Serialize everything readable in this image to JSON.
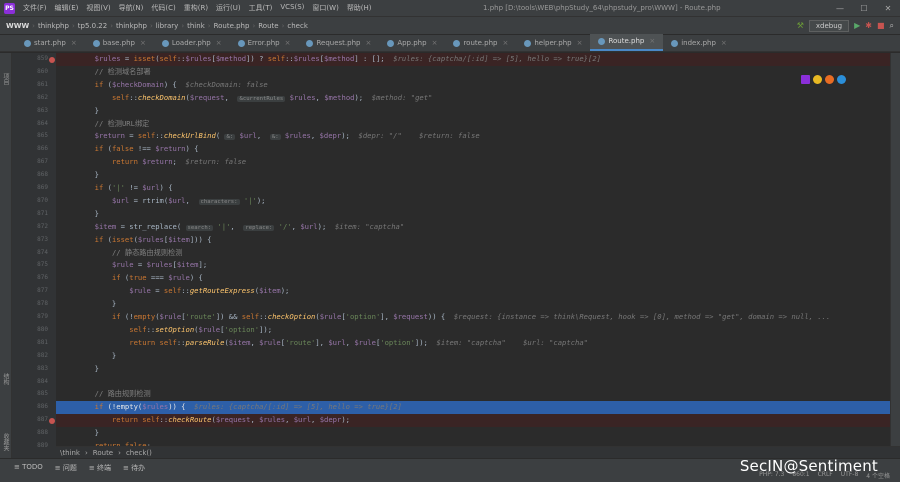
{
  "menubar": {
    "items": [
      "文件(F)",
      "编辑(E)",
      "视图(V)",
      "导航(N)",
      "代码(C)",
      "重构(R)",
      "运行(U)",
      "工具(T)",
      "VCS(S)",
      "窗口(W)",
      "帮助(H)"
    ],
    "title": "1.php [D:\\tools\\WEB\\phpStudy_64\\phpstudy_pro\\WWW] - Route.php"
  },
  "navbar": {
    "crumbs": [
      "WWW",
      "thinkphp",
      "tp5.0.22",
      "thinkphp",
      "library",
      "think",
      "Route.php",
      "Route",
      "check"
    ],
    "debug_config": "xdebug"
  },
  "tabs": [
    "start.php",
    "base.php",
    "Loader.php",
    "Error.php",
    "Request.php",
    "App.php",
    "route.php",
    "helper.php",
    "Route.php",
    "index.php"
  ],
  "inspections": {
    "warnings": "6",
    "weak_warnings": "222",
    "ok": "15"
  },
  "code": [
    {
      "n": "859",
      "parts": [
        [
          "",
          "        "
        ],
        [
          "v",
          "$rules"
        ],
        [
          "",
          " = "
        ],
        [
          "k",
          "isset"
        ],
        [
          "",
          "("
        ],
        [
          "k",
          "self"
        ],
        [
          "",
          "::"
        ],
        [
          "v",
          "$rules"
        ],
        [
          "",
          "["
        ],
        [
          "v",
          "$method"
        ],
        [
          "",
          "]) ? "
        ],
        [
          "k",
          "self"
        ],
        [
          "",
          "::"
        ],
        [
          "v",
          "$rules"
        ],
        [
          "",
          "["
        ],
        [
          "v",
          "$method"
        ],
        [
          "",
          "] : [];  "
        ],
        [
          "hint",
          "$rules: {captcha/[:id] => [5], hello => true}[2]"
        ]
      ],
      "bp": true,
      "hl": "red"
    },
    {
      "n": "860",
      "parts": [
        [
          "",
          "        "
        ],
        [
          "c",
          "// 检测域名部署"
        ]
      ]
    },
    {
      "n": "861",
      "parts": [
        [
          "",
          "        "
        ],
        [
          "k",
          "if"
        ],
        [
          "",
          " ("
        ],
        [
          "v",
          "$checkDomain"
        ],
        [
          "",
          ") {  "
        ],
        [
          "hint",
          "$checkDomain: false"
        ]
      ]
    },
    {
      "n": "862",
      "parts": [
        [
          "",
          "            "
        ],
        [
          "k",
          "self"
        ],
        [
          "",
          "::"
        ],
        [
          "f",
          "checkDomain"
        ],
        [
          "",
          "("
        ],
        [
          "v",
          "$request"
        ],
        [
          "",
          ",  "
        ],
        [
          "ph",
          "&currentRules"
        ],
        [
          "",
          " "
        ],
        [
          "v",
          "$rules"
        ],
        [
          "",
          ", "
        ],
        [
          "v",
          "$method"
        ],
        [
          "",
          ");  "
        ],
        [
          "hint",
          "$method: \"get\""
        ]
      ]
    },
    {
      "n": "863",
      "parts": [
        [
          "",
          "        }"
        ]
      ]
    },
    {
      "n": "864",
      "parts": [
        [
          "",
          "        "
        ],
        [
          "c",
          "// 检测URL绑定"
        ]
      ]
    },
    {
      "n": "865",
      "parts": [
        [
          "",
          "        "
        ],
        [
          "v",
          "$return"
        ],
        [
          "",
          " = "
        ],
        [
          "k",
          "self"
        ],
        [
          "",
          "::"
        ],
        [
          "f",
          "checkUrlBind"
        ],
        [
          "",
          "( "
        ],
        [
          "ph",
          "&:"
        ],
        [
          "",
          " "
        ],
        [
          "v",
          "$url"
        ],
        [
          "",
          ",  "
        ],
        [
          "ph",
          "&:"
        ],
        [
          "",
          " "
        ],
        [
          "v",
          "$rules"
        ],
        [
          "",
          ", "
        ],
        [
          "v",
          "$depr"
        ],
        [
          "",
          ");  "
        ],
        [
          "hint",
          "$depr: \"/\"    $return: false"
        ]
      ]
    },
    {
      "n": "866",
      "parts": [
        [
          "",
          "        "
        ],
        [
          "k",
          "if"
        ],
        [
          "",
          " ("
        ],
        [
          "k",
          "false"
        ],
        [
          "",
          " !== "
        ],
        [
          "v",
          "$return"
        ],
        [
          "",
          ") {"
        ]
      ]
    },
    {
      "n": "867",
      "parts": [
        [
          "",
          "            "
        ],
        [
          "k",
          "return"
        ],
        [
          "",
          " "
        ],
        [
          "v",
          "$return"
        ],
        [
          "",
          ";  "
        ],
        [
          "hint",
          "$return: false"
        ]
      ]
    },
    {
      "n": "868",
      "parts": [
        [
          "",
          "        }"
        ]
      ]
    },
    {
      "n": "869",
      "parts": [
        [
          "",
          "        "
        ],
        [
          "k",
          "if"
        ],
        [
          "",
          " ("
        ],
        [
          "s",
          "'|'"
        ],
        [
          "",
          " != "
        ],
        [
          "v",
          "$url"
        ],
        [
          "",
          ") {"
        ]
      ]
    },
    {
      "n": "870",
      "parts": [
        [
          "",
          "            "
        ],
        [
          "v",
          "$url"
        ],
        [
          "",
          " = rtrim("
        ],
        [
          "v",
          "$url"
        ],
        [
          "",
          ",  "
        ],
        [
          "ph",
          "characters:"
        ],
        [
          "",
          " "
        ],
        [
          "s",
          "'|'"
        ],
        [
          "",
          ");"
        ]
      ]
    },
    {
      "n": "871",
      "parts": [
        [
          "",
          "        }"
        ]
      ]
    },
    {
      "n": "872",
      "parts": [
        [
          "",
          "        "
        ],
        [
          "v",
          "$item"
        ],
        [
          "",
          " = str_replace( "
        ],
        [
          "ph",
          "search:"
        ],
        [
          "",
          " "
        ],
        [
          "s",
          "'|'"
        ],
        [
          "",
          ",  "
        ],
        [
          "ph",
          "replace:"
        ],
        [
          "",
          " "
        ],
        [
          "s",
          "'/'"
        ],
        [
          "",
          ", "
        ],
        [
          "v",
          "$url"
        ],
        [
          "",
          ");  "
        ],
        [
          "hint",
          "$item: \"captcha\""
        ]
      ]
    },
    {
      "n": "873",
      "parts": [
        [
          "",
          "        "
        ],
        [
          "k",
          "if"
        ],
        [
          "",
          " ("
        ],
        [
          "k",
          "isset"
        ],
        [
          "",
          "("
        ],
        [
          "v",
          "$rules"
        ],
        [
          "",
          "["
        ],
        [
          "v",
          "$item"
        ],
        [
          "",
          "])) {"
        ]
      ]
    },
    {
      "n": "874",
      "parts": [
        [
          "",
          "            "
        ],
        [
          "c",
          "// 静态路由规则检测"
        ]
      ]
    },
    {
      "n": "875",
      "parts": [
        [
          "",
          "            "
        ],
        [
          "v",
          "$rule"
        ],
        [
          "",
          " = "
        ],
        [
          "v",
          "$rules"
        ],
        [
          "",
          "["
        ],
        [
          "v",
          "$item"
        ],
        [
          "",
          "];"
        ]
      ]
    },
    {
      "n": "876",
      "parts": [
        [
          "",
          "            "
        ],
        [
          "k",
          "if"
        ],
        [
          "",
          " ("
        ],
        [
          "k",
          "true"
        ],
        [
          "",
          " === "
        ],
        [
          "v",
          "$rule"
        ],
        [
          "",
          ") {"
        ]
      ]
    },
    {
      "n": "877",
      "parts": [
        [
          "",
          "                "
        ],
        [
          "v",
          "$rule"
        ],
        [
          "",
          " = "
        ],
        [
          "k",
          "self"
        ],
        [
          "",
          "::"
        ],
        [
          "f",
          "getRouteExpress"
        ],
        [
          "",
          "("
        ],
        [
          "v",
          "$item"
        ],
        [
          "",
          ");"
        ]
      ]
    },
    {
      "n": "878",
      "parts": [
        [
          "",
          "            }"
        ]
      ]
    },
    {
      "n": "879",
      "parts": [
        [
          "",
          "            "
        ],
        [
          "k",
          "if"
        ],
        [
          "",
          " (!"
        ],
        [
          "k",
          "empty"
        ],
        [
          "",
          "("
        ],
        [
          "v",
          "$rule"
        ],
        [
          "",
          "["
        ],
        [
          "s",
          "'route'"
        ],
        [
          "",
          "]) && "
        ],
        [
          "k",
          "self"
        ],
        [
          "",
          "::"
        ],
        [
          "f",
          "checkOption"
        ],
        [
          "",
          "("
        ],
        [
          "v",
          "$rule"
        ],
        [
          "",
          "["
        ],
        [
          "s",
          "'option'"
        ],
        [
          "",
          "], "
        ],
        [
          "v",
          "$request"
        ],
        [
          "",
          ")) {  "
        ],
        [
          "hint",
          "$request: {instance => think\\Request, hook => [0], method => \"get\", domain => null, ..."
        ]
      ]
    },
    {
      "n": "880",
      "parts": [
        [
          "",
          "                "
        ],
        [
          "k",
          "self"
        ],
        [
          "",
          "::"
        ],
        [
          "f",
          "setOption"
        ],
        [
          "",
          "("
        ],
        [
          "v",
          "$rule"
        ],
        [
          "",
          "["
        ],
        [
          "s",
          "'option'"
        ],
        [
          "",
          "]);"
        ]
      ]
    },
    {
      "n": "881",
      "parts": [
        [
          "",
          "                "
        ],
        [
          "k",
          "return"
        ],
        [
          "",
          " "
        ],
        [
          "k",
          "self"
        ],
        [
          "",
          "::"
        ],
        [
          "f",
          "parseRule"
        ],
        [
          "",
          "("
        ],
        [
          "v",
          "$item"
        ],
        [
          "",
          ", "
        ],
        [
          "v",
          "$rule"
        ],
        [
          "",
          "["
        ],
        [
          "s",
          "'route'"
        ],
        [
          "",
          "], "
        ],
        [
          "v",
          "$url"
        ],
        [
          "",
          ", "
        ],
        [
          "v",
          "$rule"
        ],
        [
          "",
          "["
        ],
        [
          "s",
          "'option'"
        ],
        [
          "",
          "]);  "
        ],
        [
          "hint",
          "$item: \"captcha\"    $url: \"captcha\""
        ]
      ]
    },
    {
      "n": "882",
      "parts": [
        [
          "",
          "            }"
        ]
      ]
    },
    {
      "n": "883",
      "parts": [
        [
          "",
          "        }"
        ]
      ]
    },
    {
      "n": "884",
      "parts": [
        [
          "",
          ""
        ]
      ]
    },
    {
      "n": "885",
      "parts": [
        [
          "",
          "        "
        ],
        [
          "c",
          "// 路由规则检测"
        ]
      ]
    },
    {
      "n": "886",
      "parts": [
        [
          "",
          "        "
        ],
        [
          "k",
          "if"
        ],
        [
          "",
          " (!empty("
        ],
        [
          "v",
          "$rules"
        ],
        [
          "",
          ")) {  "
        ],
        [
          "hint",
          "$rules: {captcha/[:id] => [5], hello => true}[2]"
        ]
      ],
      "hl": "blue"
    },
    {
      "n": "887",
      "parts": [
        [
          "",
          "            "
        ],
        [
          "k",
          "return"
        ],
        [
          "",
          " "
        ],
        [
          "k",
          "self"
        ],
        [
          "",
          "::"
        ],
        [
          "f",
          "checkRoute"
        ],
        [
          "",
          "("
        ],
        [
          "v",
          "$request"
        ],
        [
          "",
          ", "
        ],
        [
          "v",
          "$rules"
        ],
        [
          "",
          ", "
        ],
        [
          "v",
          "$url"
        ],
        [
          "",
          ", "
        ],
        [
          "v",
          "$depr"
        ],
        [
          "",
          ");"
        ]
      ],
      "bp": true,
      "hl": "red"
    },
    {
      "n": "888",
      "parts": [
        [
          "",
          "        }"
        ]
      ]
    },
    {
      "n": "889",
      "parts": [
        [
          "",
          "        "
        ],
        [
          "k",
          "return"
        ],
        [
          "",
          " "
        ],
        [
          "k",
          "false"
        ],
        [
          "",
          ";"
        ]
      ]
    }
  ],
  "breadcrumb": [
    "\\think",
    "Route",
    "check()"
  ],
  "bottom_tools": [
    "TODO",
    "问题",
    "终端",
    "待办"
  ],
  "left_tools": [
    "项目",
    "结构",
    "收藏夹"
  ],
  "status": [
    "PHP: 7.3",
    "860:1",
    "CRLF",
    "UTF-8",
    "4 个空格"
  ],
  "watermark": "SecIN@Sentiment"
}
